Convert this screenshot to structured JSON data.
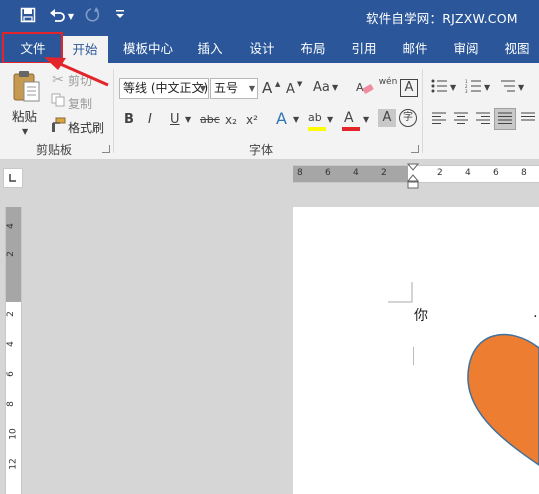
{
  "titlebar": {
    "site_text": "软件自学网：RJZXW.COM",
    "icons": [
      "save-icon",
      "undo-icon",
      "undo-dropdown-icon",
      "redo-icon",
      "customize-quick-access-icon"
    ]
  },
  "tabs": [
    {
      "label": "文件",
      "active": false
    },
    {
      "label": "开始",
      "active": true
    },
    {
      "label": "模板中心",
      "active": false
    },
    {
      "label": "插入",
      "active": false
    },
    {
      "label": "设计",
      "active": false
    },
    {
      "label": "布局",
      "active": false
    },
    {
      "label": "引用",
      "active": false
    },
    {
      "label": "邮件",
      "active": false
    },
    {
      "label": "审阅",
      "active": false
    },
    {
      "label": "视图",
      "active": false
    }
  ],
  "clipboard": {
    "group_label": "剪贴板",
    "paste_label": "粘贴",
    "cut_label": "剪切",
    "copy_label": "复制",
    "format_painter_label": "格式刷"
  },
  "font": {
    "group_label": "字体",
    "font_name": "等线 (中文正文)",
    "font_size": "五号",
    "buttons": {
      "bold": "B",
      "italic": "I",
      "underline": "U",
      "strikethrough": "abc",
      "subscript": "x₂",
      "superscript": "x²",
      "grow": "A",
      "shrink": "A",
      "change_case": "Aa",
      "phonetic": "wén",
      "char_border": "A",
      "text_effect": "A",
      "highlight": "ab",
      "font_color": "A",
      "char_shading": "A",
      "enclose": "字"
    }
  },
  "ruler": {
    "h_numbers": [
      "8",
      "6",
      "4",
      "2",
      "2",
      "4",
      "6",
      "8"
    ],
    "v_numbers": [
      "4",
      "2",
      "2",
      "4",
      "6",
      "8",
      "10",
      "12"
    ]
  },
  "document": {
    "text": "你"
  },
  "colors": {
    "brand": "#2b579a",
    "highlight_box": "#e3242b",
    "shape_fill": "#ed7d31",
    "shape_stroke": "#41719c",
    "font_color_bar": "#e3242b",
    "highlight_bar": "#ffff00"
  }
}
